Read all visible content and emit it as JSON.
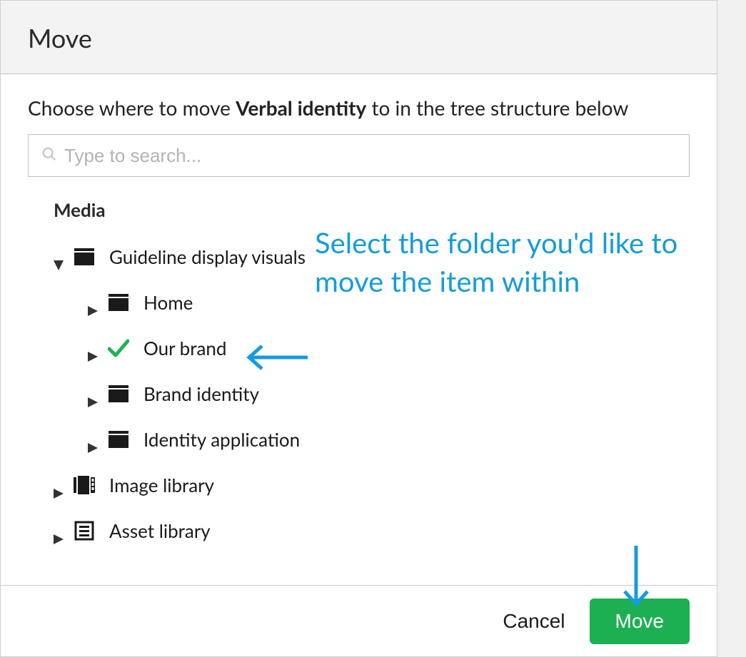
{
  "dialog": {
    "title": "Move",
    "instruction_prefix": "Choose where to move ",
    "instruction_item": "Verbal identity",
    "instruction_suffix": " to in the tree structure below",
    "search_placeholder": "Type to search..."
  },
  "tree": {
    "root": "Media",
    "nodes": [
      {
        "label": "Guideline display visuals",
        "icon": "folder",
        "expanded": true,
        "selected": false,
        "children": [
          {
            "label": "Home",
            "icon": "folder",
            "expanded": false,
            "selected": false
          },
          {
            "label": "Our brand",
            "icon": "check",
            "expanded": false,
            "selected": true
          },
          {
            "label": "Brand identity",
            "icon": "folder",
            "expanded": false,
            "selected": false
          },
          {
            "label": "Identity application",
            "icon": "folder",
            "expanded": false,
            "selected": false
          }
        ]
      },
      {
        "label": "Image library",
        "icon": "image-library",
        "expanded": false,
        "selected": false
      },
      {
        "label": "Asset library",
        "icon": "asset-library",
        "expanded": false,
        "selected": false
      }
    ]
  },
  "footer": {
    "cancel": "Cancel",
    "confirm": "Move"
  },
  "annotation": {
    "text": "Select the folder you'd like to move the item within"
  }
}
